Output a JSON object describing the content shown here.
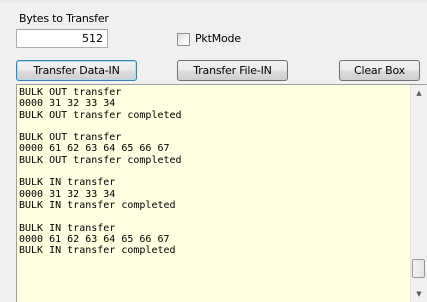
{
  "form": {
    "bytes_label": "Bytes to Transfer",
    "bytes_value": "512",
    "pktmode_label": "PktMode",
    "pktmode_checked": false
  },
  "buttons": {
    "transfer_data_in": "Transfer Data-IN",
    "transfer_file_in": "Transfer File-IN",
    "clear_box": "Clear Box"
  },
  "log": {
    "lines": [
      "BULK OUT transfer",
      "0000 31 32 33 34",
      "BULK OUT transfer completed",
      "",
      "BULK OUT transfer",
      "0000 61 62 63 64 65 66 67",
      "BULK OUT transfer completed",
      "",
      "BULK IN transfer",
      "0000 31 32 33 34",
      "BULK IN transfer completed",
      "",
      "BULK IN transfer",
      "0000 61 62 63 64 65 66 67",
      "BULK IN transfer completed"
    ]
  },
  "scrollbar": {
    "up_icon": "arrow-up-icon",
    "down_icon": "arrow-down-icon",
    "position_fraction": 0.95
  },
  "colors": {
    "log_background": "#ffffe1",
    "focus_border": "#3c7fb1"
  }
}
